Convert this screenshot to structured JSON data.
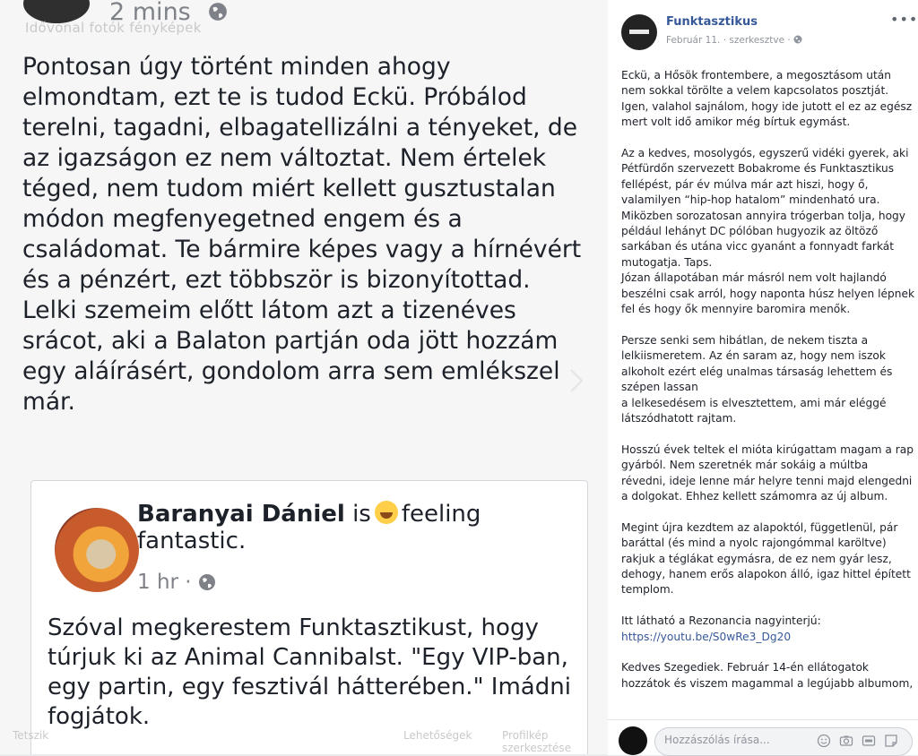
{
  "photo": {
    "time": "2 mins",
    "ghost_caption": "Idővonal fotók fényképek",
    "post_text": "Pontosan úgy történt minden ahogy elmondtam, ezt te is tudod Eckü. Próbálod terelni, tagadni, elbagatellizálni a tényeket, de az igazságon ez nem változtat. Nem értelek téged, nem tudom miért kellett gusztustalan módon megfenyegetned engem és a családomat. Te bármire képes vagy a hírnévért és a pénzért, ezt többször is bizonyítottad. Lelki szemeim előtt látom azt a tizenéves srácot, aki a Balaton partján oda jött hozzám egy aláírásért, gondolom arra sem emlékszel már.",
    "card": {
      "name": "Baranyai Dániel",
      "is": "is",
      "feeling": "feeling fantastic.",
      "time": "1 hr",
      "text": "Szóval megkerestem Funktasztikust, hogy túrjuk ki az Animal Cannibalst. \"Egy VIP-ban, egy partin, egy fesztivál hátterében.\" Imádni fogjátok."
    },
    "bottom": {
      "left": "Tetszik",
      "mid": "Lehetőségek",
      "right": "Profilkép szerkesztése"
    }
  },
  "sidebar": {
    "name": "Funktasztikus",
    "date": "Február 11.",
    "edited": "szerkesztve",
    "paragraphs": [
      "Eckü, a Hősök frontembere, a megosztásom után nem sokkal törölte a velem kapcsolatos posztját. Igen, valahol sajnálom, hogy ide jutott el ez az egész mert volt idő amikor még bírtuk egymást.",
      "Az a kedves, mosolygós, egyszerű vidéki gyerek, aki Pétfürdőn szervezett Bobakrome és Funktasztikus fellépést, pár év múlva már azt hiszi, hogy ő, valamilyen “hip-hop hatalom” mindenható ura. Miközben sorozatosan annyira trógerban tolja, hogy például lehányt DC pólóban hugyozik az öltöző sarkában és utána vicc gyanánt a fonnyadt farkát mutogatja. Taps.\nJózan állapotában már másról nem volt hajlandó beszélni csak arról, hogy naponta húsz helyen lépnek fel és hogy ők mennyire baromira menők.",
      "Persze senki sem hibátlan, de nekem tiszta a lelkiismeretem. Az én saram az, hogy nem iszok alkoholt ezért elég unalmas társaság lehettem és szépen lassan\na lelkesedésem is elvesztettem, ami már eléggé látszódhatott rajtam.",
      "Hosszú évek teltek el mióta kirúgattam magam a rap gyárból. Nem szeretnék már sokáig a múltba révedni, ideje lenne már helyre tenni majd elengedni a dolgokat. Ehhez kellett számomra az új album.",
      "Megint újra kezdtem az alapoktól, függetlenül, pár baráttal (és mind a nyolc rajongómmal karöltve) rakjuk a téglákat egymásra, de ez nem gyár lesz, dehogy, hanem erős alapokon álló, igaz hittel épített templom."
    ],
    "link_intro": "Itt látható a Rezonancia nagyinterjú:",
    "link": "https://youtu.be/S0wRe3_Dg20",
    "last_paragraph": "Kedves Szegediek. Február 14-én ellátogatok hozzátok és viszem magammal a legújabb albumom,",
    "comment_placeholder": "Hozzászólás írása..."
  }
}
